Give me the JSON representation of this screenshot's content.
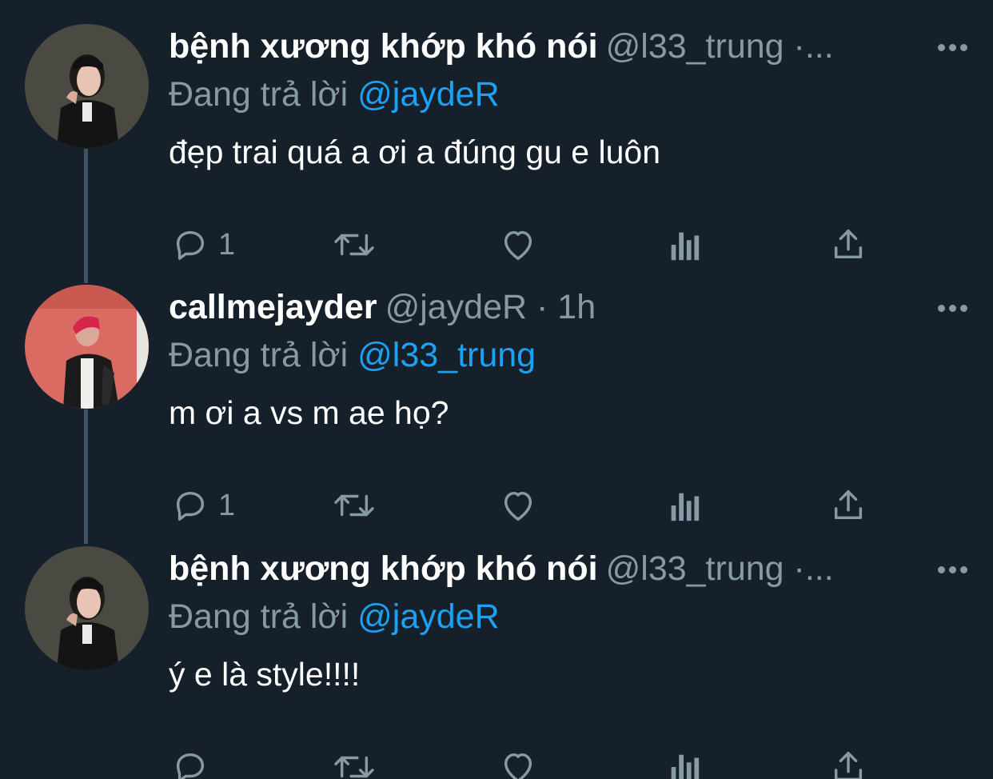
{
  "colors": {
    "background": "#15202b",
    "text_primary": "#ffffff",
    "text_secondary": "#8899a6",
    "accent": "#1da1f2",
    "thread_line": "#3d5466"
  },
  "tweets": [
    {
      "display_name": "bệnh xương khớp khó nói",
      "meta": "@l33_trung ·...",
      "reply_prefix": "Đang trả lời",
      "reply_to": "@jaydeR",
      "text": "đẹp trai quá a ơi a đúng gu e luôn",
      "reply_count": "1",
      "avatar": "avatar-dark-portrait"
    },
    {
      "display_name": "callmejayder",
      "meta": "@jaydeR · 1h",
      "reply_prefix": "Đang trả lời",
      "reply_to": "@l33_trung",
      "text": "m ơi a vs m ae họ?",
      "reply_count": "1",
      "avatar": "avatar-red-portrait"
    },
    {
      "display_name": "bệnh xương khớp khó nói",
      "meta": "@l33_trung ·...",
      "reply_prefix": "Đang trả lời",
      "reply_to": "@jaydeR",
      "text": "ý e là style!!!!",
      "reply_count": "",
      "avatar": "avatar-dark-portrait"
    }
  ],
  "icons": {
    "reply": "reply-icon",
    "retweet": "retweet-icon",
    "like": "heart-icon",
    "analytics": "analytics-icon",
    "share": "share-icon",
    "more": "more-icon"
  }
}
